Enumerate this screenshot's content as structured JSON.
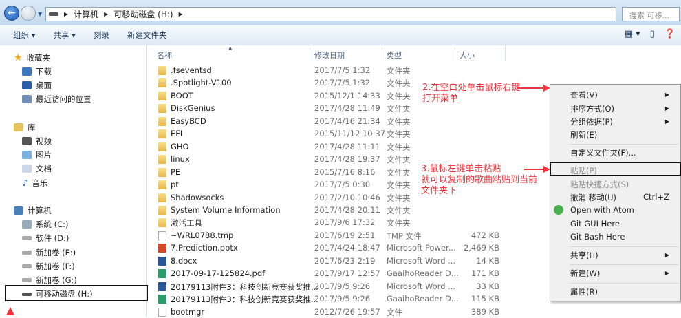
{
  "address": {
    "crumbs": [
      "计算机",
      "可移动磁盘 (H:)"
    ],
    "search_placeholder": "搜索 可移..."
  },
  "toolbar": {
    "items": [
      "组织 ▾",
      "共享 ▾",
      "刻录",
      "新建文件夹"
    ]
  },
  "sidebar": {
    "favorites": {
      "label": "收藏夹",
      "items": [
        "下载",
        "桌面",
        "最近访问的位置"
      ]
    },
    "libraries": {
      "label": "库",
      "items": [
        "视频",
        "图片",
        "文档",
        "音乐"
      ]
    },
    "computer": {
      "label": "计算机",
      "items": [
        "系统 (C:)",
        "软件 (D:)",
        "新加卷 (E:)",
        "新加卷 (F:)",
        "新加卷 (G:)",
        "可移动磁盘 (H:)"
      ]
    }
  },
  "columns": [
    "名称",
    "修改日期",
    "类型",
    "大小"
  ],
  "files": [
    {
      "name": ".fseventsd",
      "date": "2017/7/5 1:32",
      "type": "文件夹",
      "size": "",
      "icon": "folder"
    },
    {
      "name": ".Spotlight-V100",
      "date": "2017/7/5 1:32",
      "type": "文件夹",
      "size": "",
      "icon": "folder"
    },
    {
      "name": "BOOT",
      "date": "2015/12/1 14:33",
      "type": "文件夹",
      "size": "",
      "icon": "folder"
    },
    {
      "name": "DiskGenius",
      "date": "2017/4/28 11:49",
      "type": "文件夹",
      "size": "",
      "icon": "folder"
    },
    {
      "name": "EasyBCD",
      "date": "2017/4/16 21:34",
      "type": "文件夹",
      "size": "",
      "icon": "folder"
    },
    {
      "name": "EFI",
      "date": "2015/11/12 10:37",
      "type": "文件夹",
      "size": "",
      "icon": "folder"
    },
    {
      "name": "GHO",
      "date": "2017/4/28 11:11",
      "type": "文件夹",
      "size": "",
      "icon": "folder"
    },
    {
      "name": "linux",
      "date": "2017/4/28 19:37",
      "type": "文件夹",
      "size": "",
      "icon": "folder"
    },
    {
      "name": "PE",
      "date": "2015/7/16 8:16",
      "type": "文件夹",
      "size": "",
      "icon": "folder"
    },
    {
      "name": "pt",
      "date": "2017/7/5 0:30",
      "type": "文件夹",
      "size": "",
      "icon": "folder"
    },
    {
      "name": "Shadowsocks",
      "date": "2017/2/10 10:46",
      "type": "文件夹",
      "size": "",
      "icon": "folder"
    },
    {
      "name": "System Volume Information",
      "date": "2017/4/28 20:11",
      "type": "文件夹",
      "size": "",
      "icon": "folder"
    },
    {
      "name": "激活工具",
      "date": "2017/9/6 17:32",
      "type": "文件夹",
      "size": "",
      "icon": "folder"
    },
    {
      "name": "~WRL0788.tmp",
      "date": "2017/6/19 2:51",
      "type": "TMP 文件",
      "size": "472 KB",
      "icon": "doc"
    },
    {
      "name": "7.Prediction.pptx",
      "date": "2017/4/24 18:47",
      "type": "Microsoft Power...",
      "size": "2,469 KB",
      "icon": "ppt"
    },
    {
      "name": "8.docx",
      "date": "2017/6/23 2:19",
      "type": "Microsoft Word ...",
      "size": "14 KB",
      "icon": "word"
    },
    {
      "name": "2017-09-17-125824.pdf",
      "date": "2017/9/17 12:57",
      "type": "GaaihoReader D...",
      "size": "171 KB",
      "icon": "pdf"
    },
    {
      "name": "20179113附件3：科技创新竞赛获奖推...",
      "date": "2017/9/5 9:26",
      "type": "Microsoft Word ...",
      "size": "33 KB",
      "icon": "word"
    },
    {
      "name": "20179113附件3：科技创新竞赛获奖推...",
      "date": "2017/9/5 9:26",
      "type": "GaaihoReader D...",
      "size": "115 KB",
      "icon": "pdf"
    },
    {
      "name": "bootmgr",
      "date": "2012/7/26 19:57",
      "type": "文件",
      "size": "389 KB",
      "icon": "doc"
    }
  ],
  "context_menu": [
    {
      "label": "查看(V)",
      "sub": true
    },
    {
      "label": "排序方式(O)",
      "sub": true
    },
    {
      "label": "分组依据(P)",
      "sub": true
    },
    {
      "label": "刷新(E)"
    },
    {
      "sep": true
    },
    {
      "label": "自定义文件夹(F)..."
    },
    {
      "sep": true
    },
    {
      "label": "粘贴(P)",
      "disabled": true
    },
    {
      "label": "粘贴快捷方式(S)",
      "disabled": true
    },
    {
      "label": "撤消 移动(U)",
      "shortcut": "Ctrl+Z"
    },
    {
      "label": "Open with Atom",
      "icon": "atom"
    },
    {
      "label": "Git GUI Here"
    },
    {
      "label": "Git Bash Here"
    },
    {
      "sep": true
    },
    {
      "label": "共享(H)",
      "sub": true
    },
    {
      "sep": true
    },
    {
      "label": "新建(W)",
      "sub": true
    },
    {
      "sep": true
    },
    {
      "label": "属性(R)"
    }
  ],
  "annotations": {
    "step2": [
      "2.在空白处单击鼠标右键",
      "打开菜单"
    ],
    "step3": [
      "3.鼠标左键单击粘贴",
      "就可以复制的歌曲粘贴到当前",
      "文件夹下"
    ]
  },
  "colors": {
    "annotation": "#f2333c"
  }
}
